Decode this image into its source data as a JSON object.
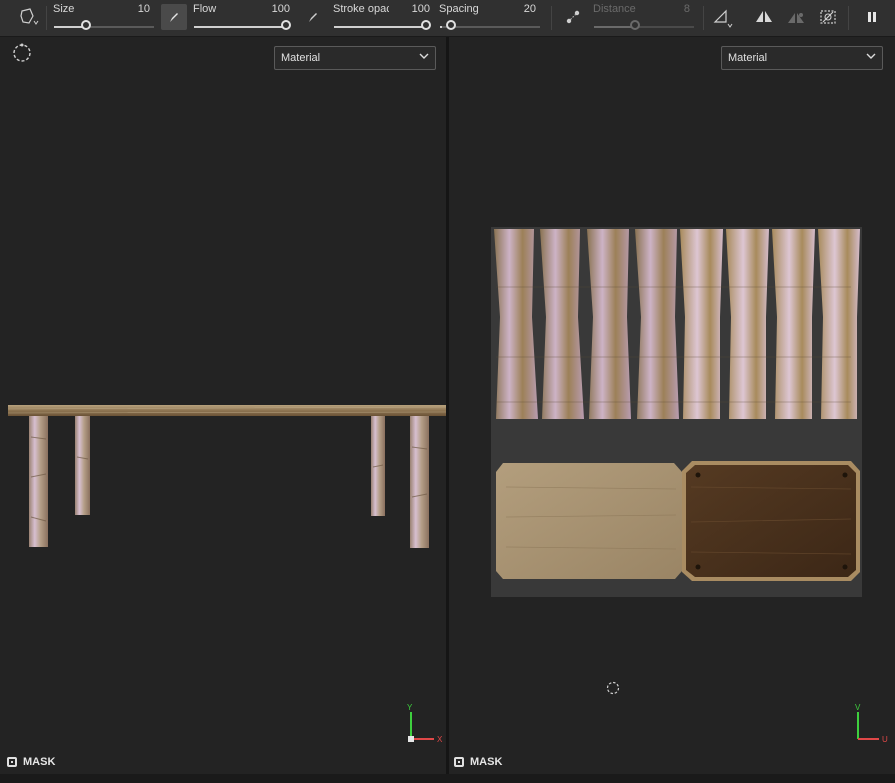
{
  "toolbar": {
    "brush_tool_icon": "brush-shape-icon",
    "size": {
      "label": "Size",
      "value": "10",
      "fraction": 0.33
    },
    "flow": {
      "label": "Flow",
      "value": "100",
      "fraction": 1.0
    },
    "stroke_opacity": {
      "label": "Stroke opac",
      "value": "100",
      "fraction": 1.0
    },
    "spacing": {
      "label": "Spacing",
      "value": "20",
      "fraction": 0.02
    },
    "distance": {
      "label": "Distance",
      "value": "8",
      "fraction": 0.42,
      "disabled": true
    },
    "icons": [
      "flow-pen-icon",
      "stroke-opacity-pen-icon",
      "lazy-mouse-icon",
      "symmetry-icon",
      "mirror-icon",
      "mirror-disabled-icon",
      "stencil-icon",
      "pause-icon"
    ]
  },
  "viewport_3d": {
    "dropdown": "Material",
    "camera_icon": "camera-orbit-icon",
    "mask_label": "MASK",
    "axes": {
      "y": "Y",
      "x": "X"
    }
  },
  "viewport_2d": {
    "dropdown": "Material",
    "mask_label": "MASK",
    "axes": {
      "v": "V",
      "u": "U"
    }
  },
  "colors": {
    "toolbar_bg": "#303030",
    "viewport_bg": "#232323",
    "axis_y": "#3ecf3e",
    "axis_x": "#e04848",
    "wood_light": "#a89474",
    "wood_dark": "#4a3220",
    "bark_lilac": "#c7aac0"
  }
}
